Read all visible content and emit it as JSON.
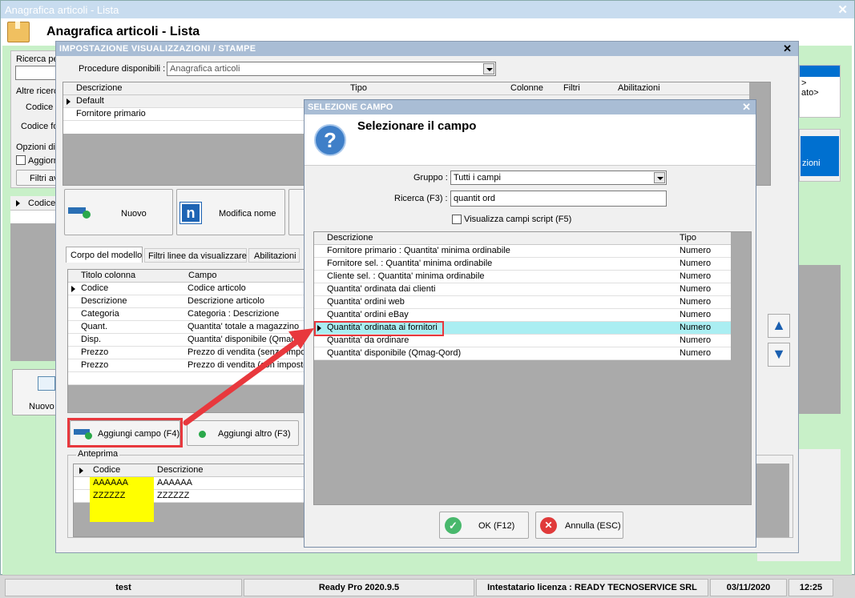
{
  "main_window": {
    "title": "Anagrafica articoli  - Lista",
    "header_title": "Anagrafica articoli  - Lista",
    "left_labels": {
      "ricerca": "Ricerca pe",
      "altre_ricerche": "Altre ricerc",
      "codice_a": "Codice a",
      "codice_fo": "Codice fo",
      "opzioni": "Opzioni di",
      "aggiorna": "Aggiorn",
      "filtri": "Filtri av",
      "codice_col": "Codice",
      "nuovo": "Nuovo"
    },
    "right_snippets": {
      "line1": ">",
      "line2": "ato>",
      "btn": "zioni"
    }
  },
  "settings_dialog": {
    "title": "IMPOSTAZIONE VISUALIZZAZIONI / STAMPE",
    "procedure_label": "Procedure disponibili :",
    "procedure_value": "Anagrafica articoli",
    "models_columns": [
      "Descrizione",
      "Tipo",
      "Colonne",
      "Filtri",
      "Abilitazioni"
    ],
    "models_rows": [
      "Default",
      "Fornitore primario"
    ],
    "btn_nuovo": "Nuovo",
    "btn_modifica": "Modifica nome",
    "tabs": [
      "Corpo del modello",
      "Filtri linee da visualizzare",
      "Abilitazioni"
    ],
    "fields_columns": [
      "Titolo colonna",
      "Campo"
    ],
    "fields_rows": [
      [
        "Codice",
        "Codice articolo"
      ],
      [
        "Descrizione",
        "Descrizione articolo"
      ],
      [
        "Categoria",
        "Categoria : Descrizione"
      ],
      [
        "Quant.",
        "Quantita' totale a magazzino"
      ],
      [
        "Disp.",
        "Quantita' disponibile (Qmag"
      ],
      [
        "Prezzo",
        "Prezzo di vendita (senza impos"
      ],
      [
        "Prezzo",
        "Prezzo di vendita (con imposte"
      ]
    ],
    "btn_aggiungi_campo": "Aggiungi campo (F4)",
    "btn_aggiungi_altro": "Aggiungi altro (F3)",
    "anteprima_label": "Anteprima",
    "preview_columns": [
      "Codice",
      "Descrizione"
    ],
    "preview_rows": [
      [
        "AAAAAA",
        "AAAAAA"
      ],
      [
        "ZZZZZZ",
        "ZZZZZZ"
      ]
    ]
  },
  "field_dialog": {
    "title": "SELEZIONE CAMPO",
    "heading": "Selezionare il campo",
    "gruppo_label": "Gruppo :",
    "gruppo_value": "Tutti i campi",
    "ricerca_label": "Ricerca (F3) :",
    "ricerca_value": "quantit ord",
    "checkbox_label": "Visualizza campi script (F5)",
    "columns": [
      "Descrizione",
      "Tipo"
    ],
    "rows": [
      [
        "Fornitore primario : Quantita' minima ordinabile",
        "Numero"
      ],
      [
        "Fornitore sel. : Quantita' minima ordinabile",
        "Numero"
      ],
      [
        "Cliente sel. : Quantita' minima ordinabile",
        "Numero"
      ],
      [
        "Quantita' ordinata dai clienti",
        "Numero"
      ],
      [
        "Quantita' ordini web",
        "Numero"
      ],
      [
        "Quantita' ordini eBay",
        "Numero"
      ],
      [
        "Quantita' ordinata ai fornitori",
        "Numero"
      ],
      [
        "Quantita' da ordinare",
        "Numero"
      ],
      [
        "Quantita' disponibile (Qmag-Qord)",
        "Numero"
      ]
    ],
    "selected_index": 6,
    "btn_ok": "OK (F12)",
    "btn_annulla": "Annulla (ESC)"
  },
  "statusbar": {
    "user": "test",
    "version": "Ready Pro 2020.9.5",
    "license": "Intestatario licenza : READY TECNOSERVICE SRL",
    "date": "03/11/2020",
    "time": "12:25"
  },
  "colors": {
    "title_blue": "#cfe3f3",
    "dialog_title": "#a8bdd5",
    "selection": "#aaeef2",
    "highlight_red": "#e8383d",
    "preview_yellow": "#ffff00",
    "green_bg": "#c4f0c4",
    "accent_blue": "#0070d0"
  }
}
